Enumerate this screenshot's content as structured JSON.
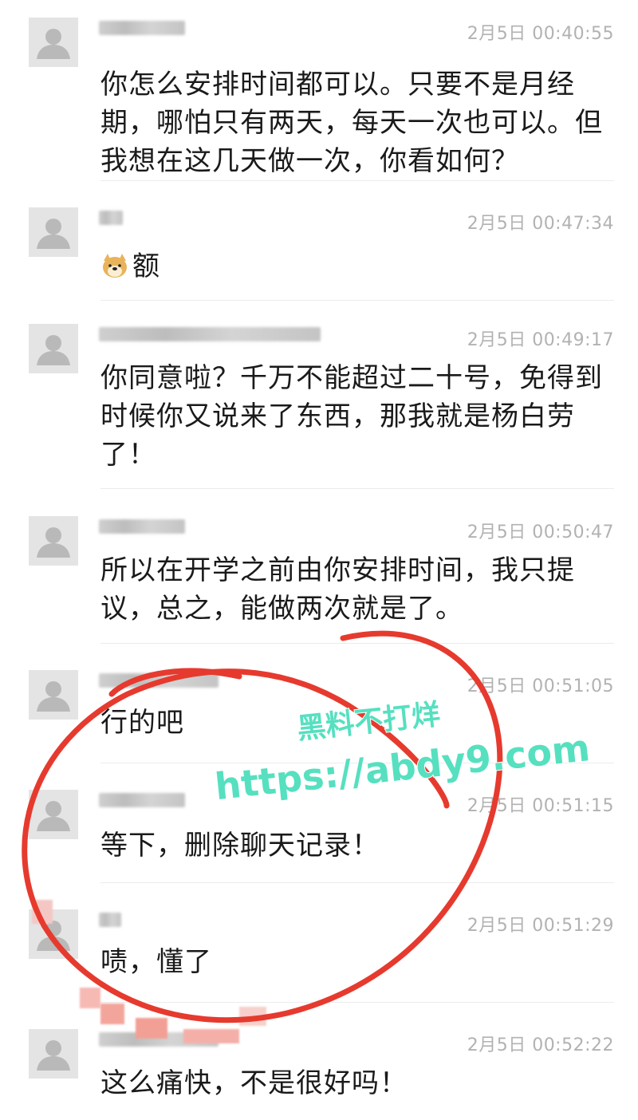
{
  "colors": {
    "annotation_circle": "#e63a2e",
    "watermark": "#56e0c0",
    "timestamp": "#b2b2b2",
    "message_text": "#1a1a1a"
  },
  "messages": [
    {
      "time": "2月5日 00:40:55",
      "text": "你怎么安排时间都可以。只要不是月经期，哪怕只有两天，每天一次也可以。但我想在这几天做一次，你看如何？",
      "avatar_icon": "default-user-icon"
    },
    {
      "time": "2月5日 00:47:34",
      "text": "额",
      "emoji": "doge-emoji-icon",
      "avatar_icon": "default-user-icon"
    },
    {
      "time": "2月5日 00:49:17",
      "text": "你同意啦？千万不能超过二十号，免得到时候你又说来了东西，那我就是杨白劳了！",
      "avatar_icon": "default-user-icon"
    },
    {
      "time": "2月5日 00:50:47",
      "text": "所以在开学之前由你安排时间，我只提议，总之，能做两次就是了。",
      "avatar_icon": "default-user-icon"
    },
    {
      "time": "2月5日 00:51:05",
      "text": "行的吧",
      "avatar_icon": "default-user-icon"
    },
    {
      "time": "2月5日 00:51:15",
      "text": "等下，删除聊天记录！",
      "avatar_icon": "default-user-icon"
    },
    {
      "time": "2月5日 00:51:29",
      "text": "啧，懂了",
      "avatar_icon": "default-user-icon"
    },
    {
      "time": "2月5日 00:52:22",
      "text": "这么痛快，不是很好吗！",
      "avatar_icon": "default-user-icon"
    }
  ],
  "watermark": {
    "line1": "黑料不打烊",
    "line2": "https://abdy9.com"
  }
}
